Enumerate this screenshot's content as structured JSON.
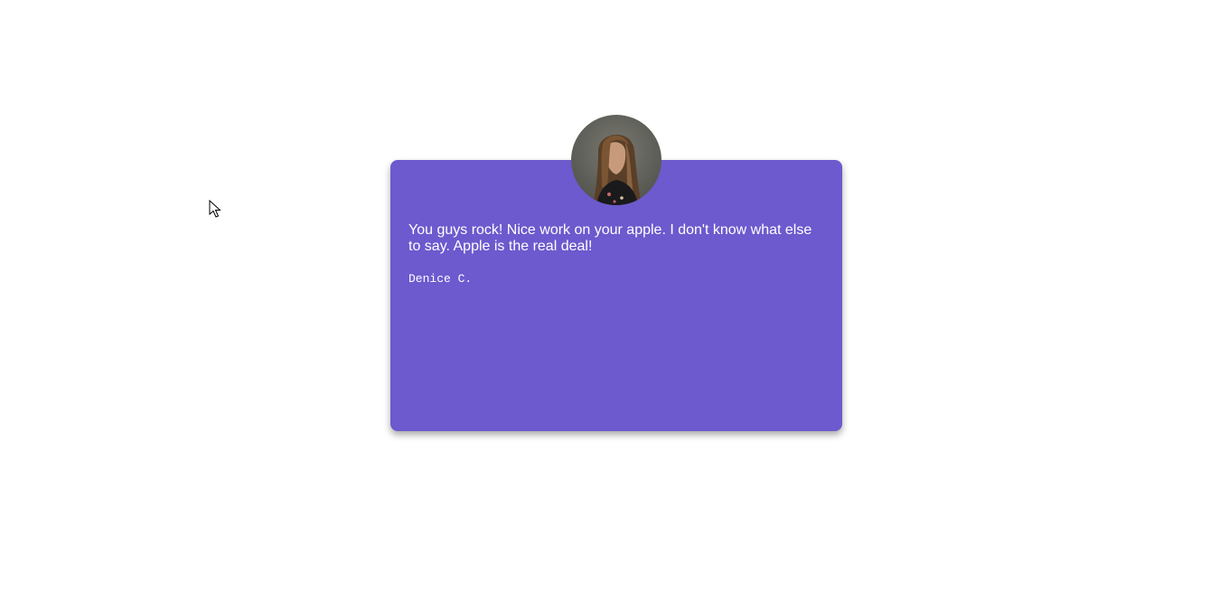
{
  "testimonial": {
    "quote": "You guys rock! Nice work on your apple. I don't know what else to say. Apple is the real deal!",
    "author": "Denice C.",
    "avatar_icon": "person-photo",
    "card_color": "#6c5ace"
  },
  "cursor_icon": "mouse-pointer-icon"
}
